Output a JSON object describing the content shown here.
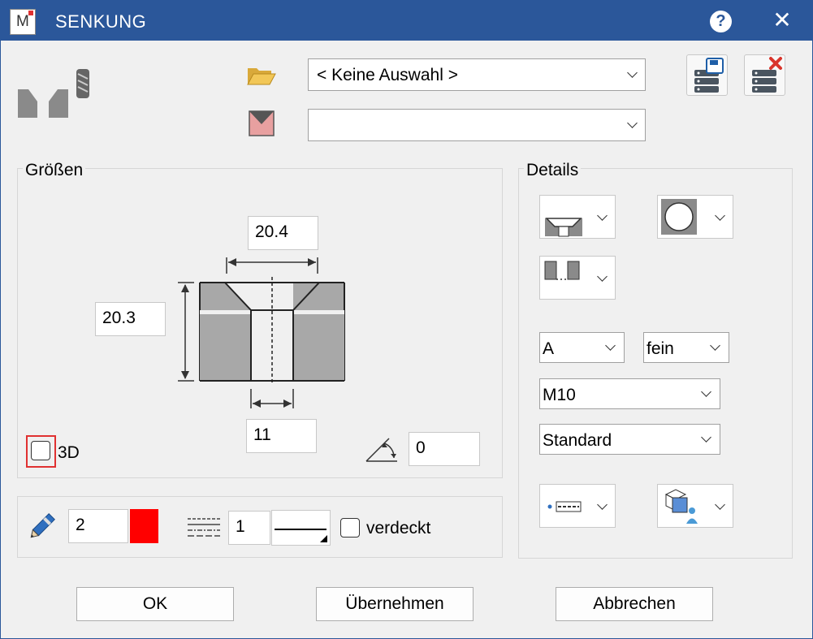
{
  "window": {
    "title": "SENKUNG",
    "app_icon_letter": "M"
  },
  "titlebar": {
    "help_label": "?",
    "close_label": "✕"
  },
  "top": {
    "selection_combo": {
      "value": "< Keine Auswahl >"
    },
    "second_combo": {
      "value": ""
    }
  },
  "sizes": {
    "group_label": "Größen",
    "top_width": "20.4",
    "height": "20.3",
    "bottom_width": "11",
    "angle": "0",
    "three_d_label": "3D"
  },
  "details": {
    "group_label": "Details",
    "combo_a": "A",
    "combo_fein": "fein",
    "combo_thread": "M10",
    "combo_standard": "Standard"
  },
  "line": {
    "pen_value": "2",
    "pen_color": "#ff0000",
    "linetype_value": "1",
    "hidden_label": "verdeckt"
  },
  "buttons": {
    "ok": "OK",
    "apply": "Übernehmen",
    "cancel": "Abbrechen"
  },
  "colors": {
    "titlebar": "#2b579a",
    "highlight": "#e03131"
  }
}
